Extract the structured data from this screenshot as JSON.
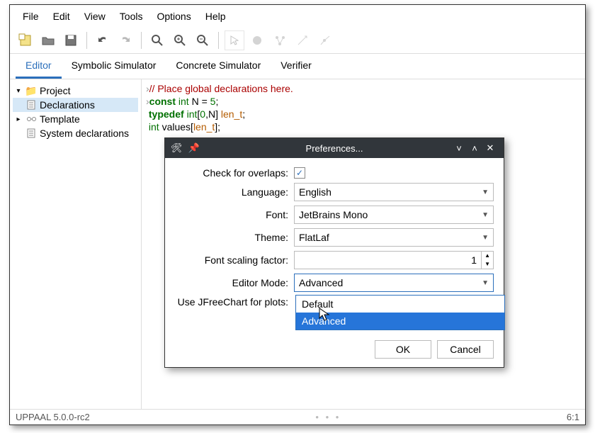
{
  "menubar": {
    "file": "File",
    "edit": "Edit",
    "view": "View",
    "tools": "Tools",
    "options": "Options",
    "help": "Help"
  },
  "tabs": {
    "editor": "Editor",
    "symsim": "Symbolic Simulator",
    "concsim": "Concrete Simulator",
    "verifier": "Verifier"
  },
  "tree": {
    "project": "Project",
    "declarations": "Declarations",
    "template": "Template",
    "sysdecl": "System declarations"
  },
  "code": {
    "l1_cmt": "// Place global declarations here.",
    "l2_kw": "const",
    "l2_type": " int",
    "l2_rest": " N = ",
    "l2_num": "5",
    "l2_semi": ";",
    "l3_kw": "typedef",
    "l3_type": " int",
    "l3_br": "[",
    "l3_a": "0",
    "l3_c": ",N] ",
    "l3_name": "len_t",
    "l3_semi": ";",
    "l4_type": "int",
    "l4_sp": " values[",
    "l4_var": "len_t",
    "l4_end": "];"
  },
  "status": {
    "left": "UPPAAL 5.0.0-rc2",
    "right": "6:1"
  },
  "dialog": {
    "title": "Preferences...",
    "labels": {
      "overlaps": "Check for overlaps:",
      "language": "Language:",
      "font": "Font:",
      "theme": "Theme:",
      "scaling": "Font scaling factor:",
      "mode": "Editor Mode:",
      "jfree": "Use JFreeChart for plots:"
    },
    "values": {
      "overlaps_checked": "✓",
      "language": "English",
      "font": "JetBrains Mono",
      "theme": "FlatLaf",
      "scaling": "1",
      "mode": "Advanced"
    },
    "options": {
      "opt1": "Default",
      "opt2": "Advanced"
    },
    "buttons": {
      "ok": "OK",
      "cancel": "Cancel"
    }
  }
}
